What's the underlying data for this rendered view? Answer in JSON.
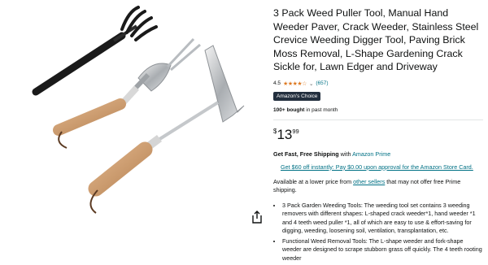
{
  "product": {
    "title": "3 Pack Weed Puller Tool, Manual Hand Weeder Paver, Crack Weeder, Stainless Steel Crevice Weeding Digger Tool, Paving Brick Moss Removal, L-Shape Gardening Crack Sickle for, Lawn Edger and Driveway",
    "rating_value": "4.5",
    "stars": "★★★★☆",
    "rating_count": "(657)",
    "choice_badge": "Amazon's Choice",
    "bought_strong": "100+ bought",
    "bought_rest": " in past month",
    "price_symbol": "$",
    "price_whole": "13",
    "price_fraction": "99",
    "shipping_strong": "Get Fast, Free Shipping",
    "shipping_with": " with ",
    "shipping_brand": "Amazon Prime",
    "card_offer": "Get $60 off instantly: Pay $0.00 upon approval for the Amazon Store Card.",
    "avail_before": "Available at a lower price from ",
    "avail_link": "other sellers",
    "avail_after": " that may not offer free Prime shipping.",
    "bullets": [
      "3 Pack Garden Weeding Tools: The weeding tool set contains 3 weeding removers with different shapes: L-shaped crack weeder*1, hand weeder *1 and 4 teeth weed puller *1, all of which are easy to use & effort-saving for digging, weeding, loosening soil, ventilation, transplantation, etc.",
      "Functional Weed Removal Tools: The L-shape weeder and fork-shape weeder are designed to scrape stubborn grass off quickly. The 4 teeth rooting weeder"
    ]
  },
  "icons": {
    "share": "share-icon"
  },
  "colors": {
    "link": "#007185",
    "badge_bg": "#232f3e",
    "star": "#de7921",
    "wood": "#c99a6a"
  }
}
